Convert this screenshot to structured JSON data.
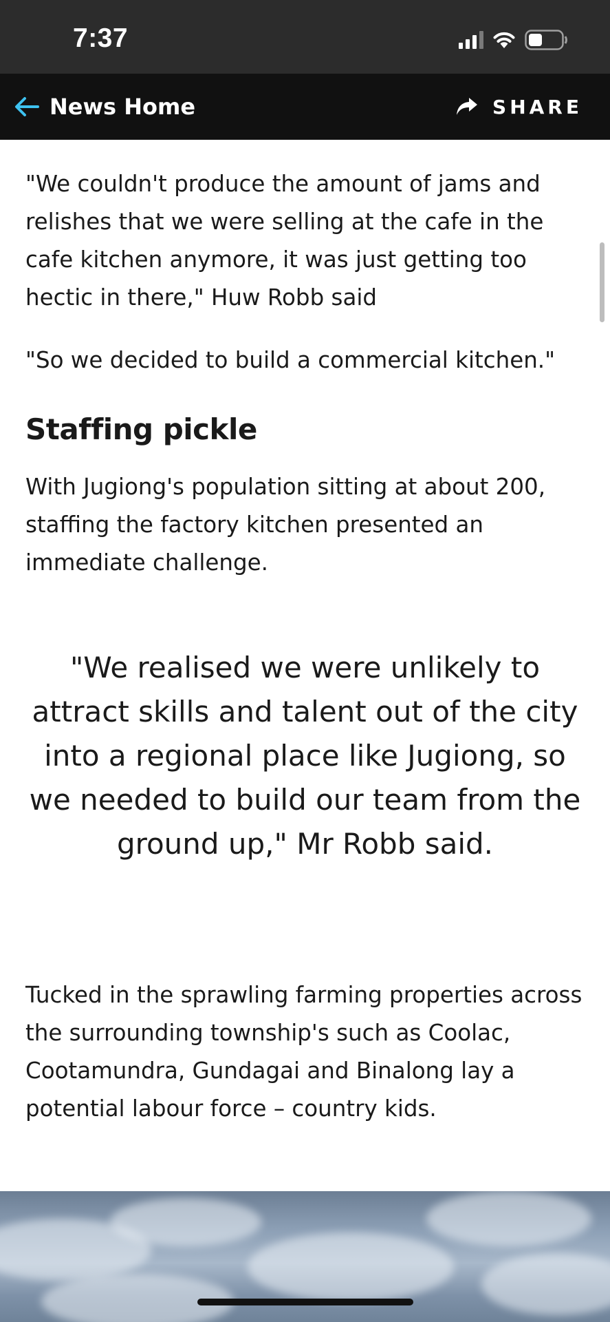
{
  "status_bar": {
    "time": "7:37",
    "icons": [
      "cellular-signal-icon",
      "wifi-icon",
      "battery-icon"
    ]
  },
  "nav": {
    "back_label": "News Home",
    "share_label": "SHARE",
    "accent_color": "#3ec2f0"
  },
  "article": {
    "paragraph_1": "\"We couldn't produce the amount of jams and relishes that we were selling at the cafe in the cafe kitchen anymore, it was just getting too hectic in there,\" Huw Robb said",
    "paragraph_2": "\"So we decided to build a commercial kitchen.\"",
    "subheading": "Staffing pickle",
    "paragraph_3": "With Jugiong's population sitting at about 200, staffing the factory kitchen presented an immediate challenge.",
    "pull_quote": "\"We realised we were unlikely to attract skills and talent out of the city into a regional place like Jugiong, so we needed to build our team from the ground up,\" Mr Robb said.",
    "paragraph_4": "Tucked in the sprawling farming properties across the surrounding township's such as Coolac, Cootamundra, Gundagai and Binalong lay a potential labour force – country kids."
  }
}
